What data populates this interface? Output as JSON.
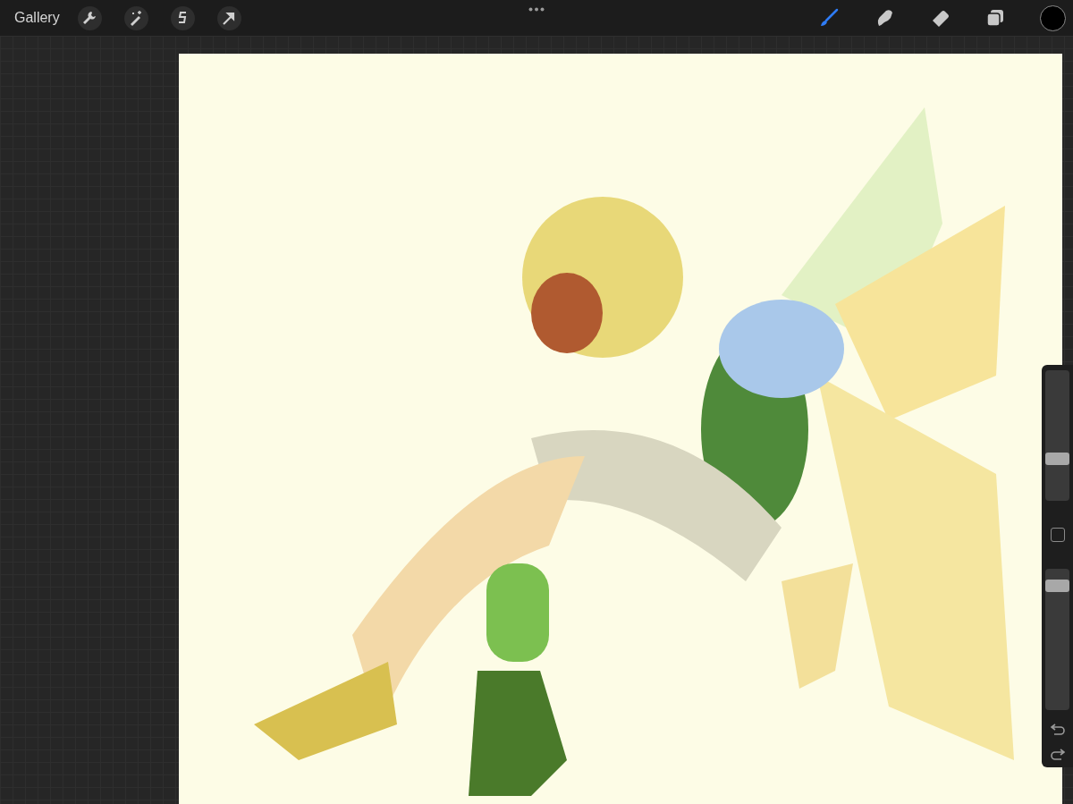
{
  "top_bar": {
    "gallery_label": "Gallery",
    "actions": [
      {
        "kind": "wrench"
      },
      {
        "kind": "wand"
      },
      {
        "kind": "selection"
      },
      {
        "kind": "move"
      }
    ],
    "tools": [
      {
        "kind": "brush",
        "selected": true
      },
      {
        "kind": "smudge",
        "selected": false
      },
      {
        "kind": "eraser",
        "selected": false
      },
      {
        "kind": "layers",
        "selected": false
      }
    ],
    "current_color": {
      "color": "#000000"
    }
  },
  "side_panel": {
    "brush_size": {
      "level": 0.3
    },
    "opacity": {
      "level": 0.92
    }
  }
}
